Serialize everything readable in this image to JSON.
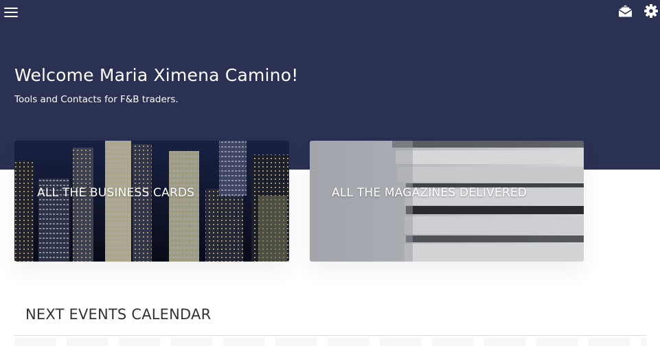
{
  "header": {
    "menu_icon": "hamburger-menu-icon",
    "mail_icon": "envelope-open-icon",
    "settings_icon": "gear-icon",
    "background_color": "#2b3153"
  },
  "hero": {
    "welcome": "Welcome Maria Ximena Camino!",
    "subtitle": "Tools and Contacts for F&B traders."
  },
  "cards": [
    {
      "label": "ALL THE BUSINESS CARDS"
    },
    {
      "label": "ALL THE MAGAZINES DELIVERED"
    }
  ],
  "events": {
    "title": "NEXT EVENTS CALENDAR"
  }
}
